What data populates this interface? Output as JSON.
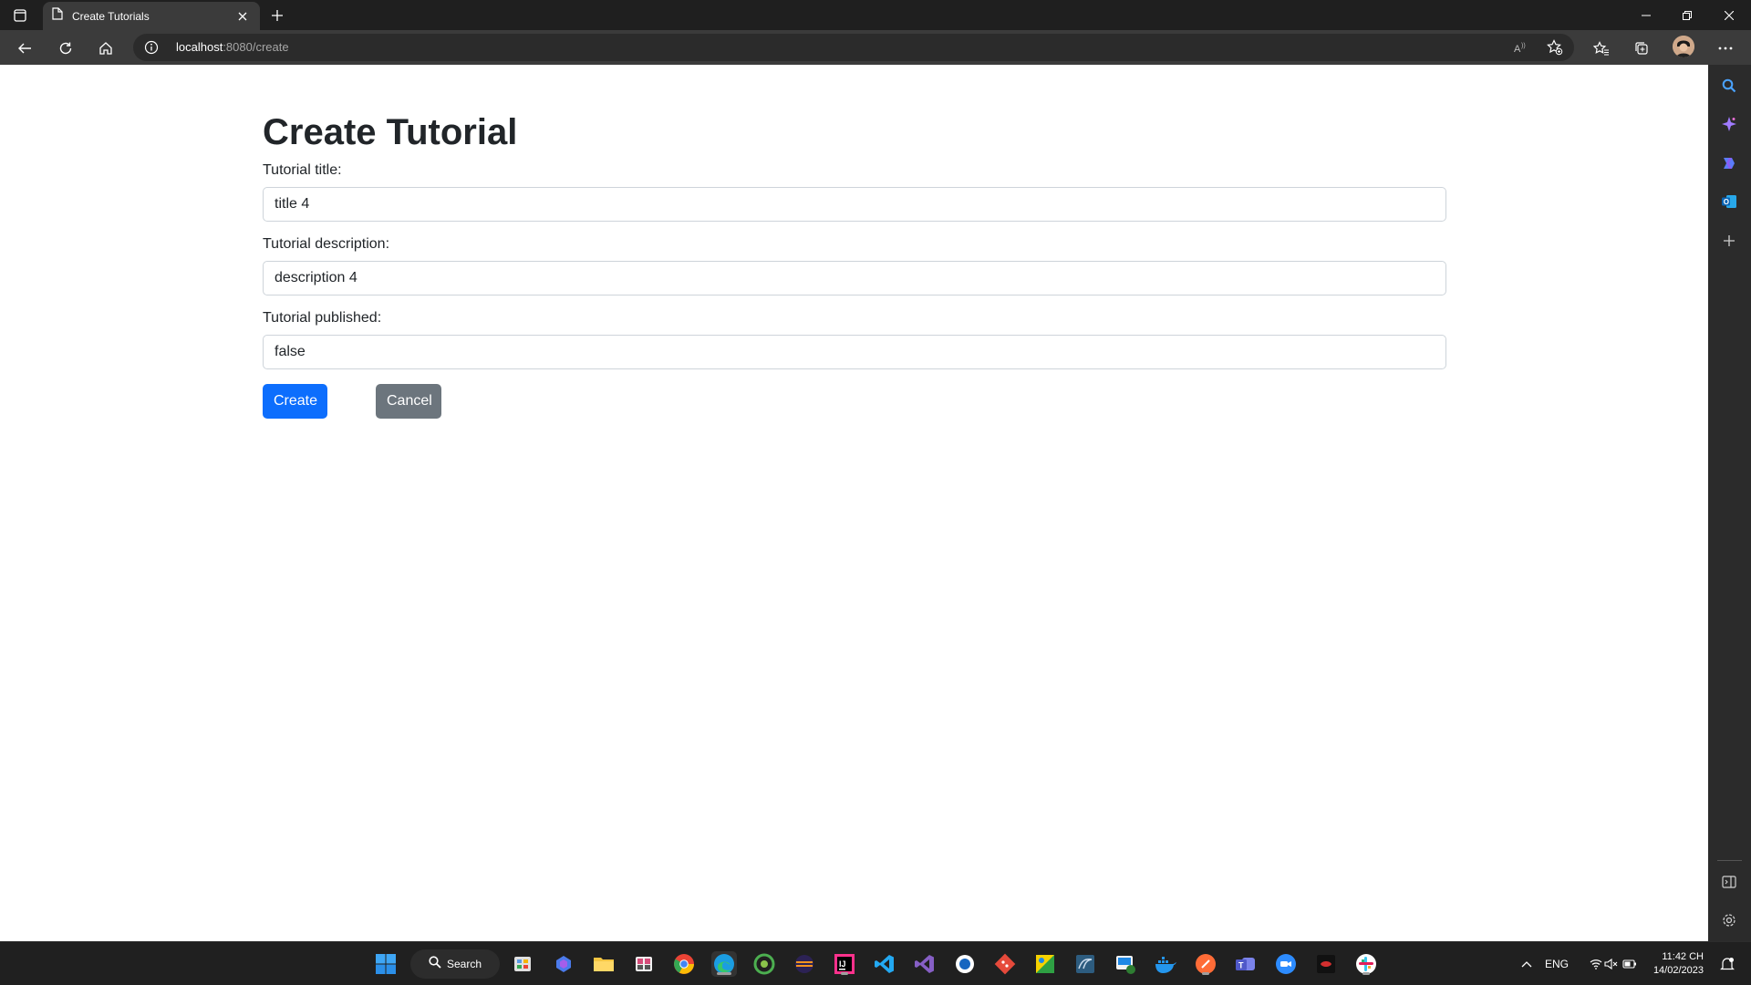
{
  "browser": {
    "tab_title": "Create Tutorials",
    "url_host": "localhost",
    "url_path": ":8080/create"
  },
  "page": {
    "heading": "Create Tutorial",
    "fields": [
      {
        "label": "Tutorial title:",
        "value": "title 4"
      },
      {
        "label": "Tutorial description:",
        "value": "description 4"
      },
      {
        "label": "Tutorial published:",
        "value": "false"
      }
    ],
    "create_label": "Create",
    "cancel_label": "Cancel"
  },
  "taskbar": {
    "search_label": "Search",
    "language": "ENG",
    "time": "11:42 CH",
    "date": "14/02/2023"
  },
  "colors": {
    "primary": "#0d6efd",
    "secondary": "#6c757d"
  }
}
